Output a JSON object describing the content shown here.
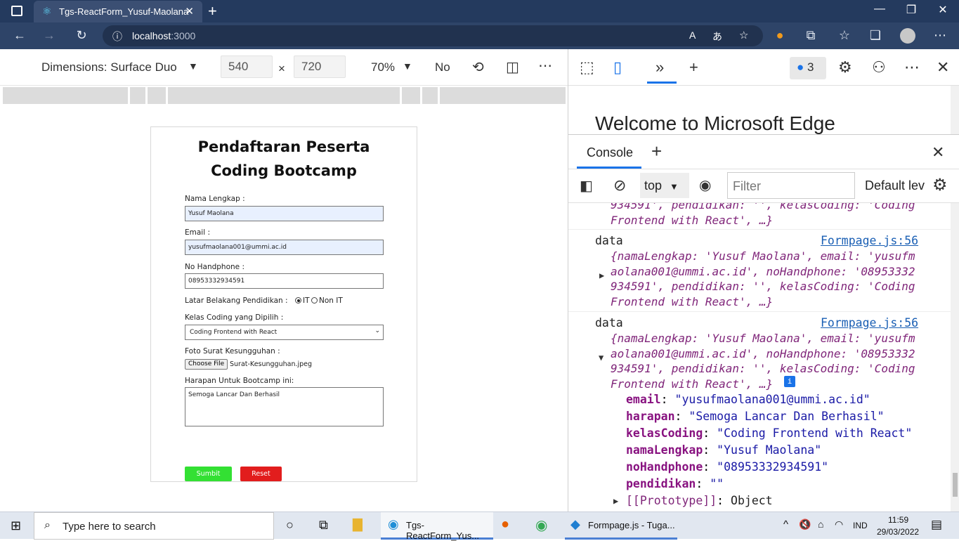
{
  "browser": {
    "tab_title": "Tgs-ReactForm_Yusuf-Maolana",
    "url_host": "localhost",
    "url_port": ":3000"
  },
  "device_toolbar": {
    "dimensions_label": "Dimensions: Surface Duo",
    "width": "540",
    "height": "720",
    "times": "×",
    "zoom": "70%",
    "throttle": "No"
  },
  "form": {
    "title_line1": "Pendaftaran Peserta",
    "title_line2": "Coding Bootcamp",
    "nama_label": "Nama Lengkap :",
    "nama_value": "Yusuf Maolana",
    "email_label": "Email :",
    "email_value": "yusufmaolana001@ummi.ac.id",
    "phone_label": "No Handphone :",
    "phone_value": "08953332934591",
    "pendidikan_label": "Latar Belakang Pendidikan :",
    "pendidikan_opt1": "IT",
    "pendidikan_opt2": "Non IT",
    "kelas_label": "Kelas Coding yang Dipilih :",
    "kelas_value": "Coding Frontend with React",
    "foto_label": "Foto Surat Kesungguhan :",
    "choose_file": "Choose File",
    "file_name": "Surat-Kesungguhan.jpeg",
    "harapan_label": "Harapan Untuk Bootcamp ini:",
    "harapan_value": "Semoga Lancar Dan Berhasil",
    "submit_label": "Sumbit",
    "reset_label": "Reset",
    "submit_color": "#33e033",
    "reset_color": "#e21d1d"
  },
  "devtools": {
    "issues_count": "3",
    "welcome": "Welcome to Microsoft Edge",
    "console_tab": "Console",
    "context": "top",
    "filter_placeholder": "Filter",
    "levels": "Default lev",
    "log0_tail": "934591', pendidikan: '', kelasCoding: 'Coding",
    "log0_tail2": "Frontend with React', …}",
    "log_label": "data",
    "log_source": "Formpage.js:56",
    "obj_line1": "{namaLengkap: 'Yusuf Maolana', email: 'yusufm",
    "obj_line2": "aolana001@ummi.ac.id', noHandphone: '08953332",
    "obj_line3": "934591', pendidikan: '', kelasCoding: 'Coding",
    "obj_line4": "Frontend with React', …}",
    "props": [
      {
        "key": "email",
        "value": "\"yusufmaolana001@ummi.ac.id\""
      },
      {
        "key": "harapan",
        "value": "\"Semoga Lancar Dan Berhasil\""
      },
      {
        "key": "kelasCoding",
        "value": "\"Coding Frontend with React\""
      },
      {
        "key": "namaLengkap",
        "value": "\"Yusuf Maolana\""
      },
      {
        "key": "noHandphone",
        "value": "\"08953332934591\""
      },
      {
        "key": "pendidikan",
        "value": "\"\""
      }
    ],
    "prototype_key": "[[Prototype]]",
    "prototype_value": "Object"
  },
  "taskbar": {
    "search_placeholder": "Type here to search",
    "edge_app": "Tgs-ReactForm_Yus...",
    "vscode_app": "Formpage.js - Tuga...",
    "lang": "IND",
    "time": "11:59",
    "date": "29/03/2022"
  }
}
